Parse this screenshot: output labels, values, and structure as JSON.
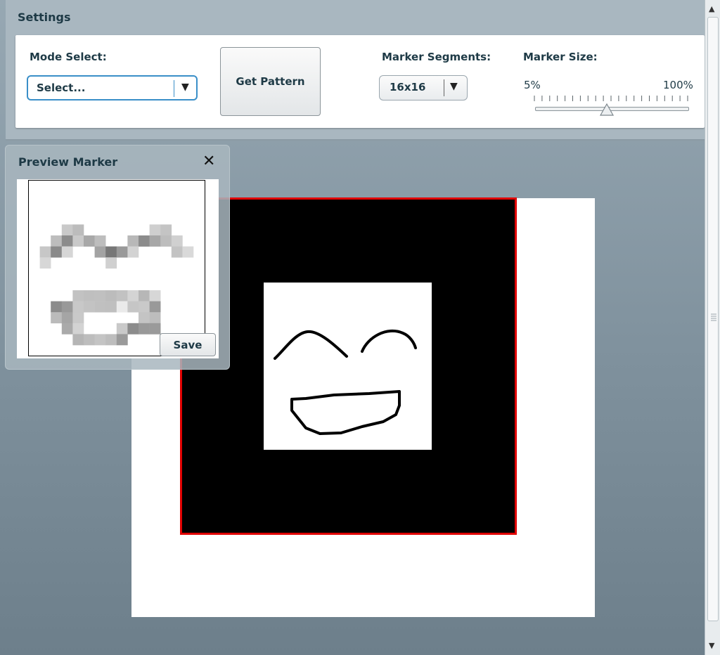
{
  "settings": {
    "title": "Settings",
    "mode_select": {
      "label": "Mode Select:",
      "value": "Select..."
    },
    "get_pattern_label": "Get Pattern",
    "marker_segments": {
      "label": "Marker Segments:",
      "value": "16x16"
    },
    "marker_size": {
      "label": "Marker Size:",
      "min_label": "5%",
      "max_label": "100%",
      "value_fraction": 0.47
    }
  },
  "preview": {
    "title": "Preview Marker",
    "save_label": "Save"
  },
  "colors": {
    "accent": "#3a8fc8",
    "marker_border": "#e00000",
    "marker_fill": "#000000"
  },
  "icons": {
    "close": "close-icon",
    "dropdown": "chevron-down-icon",
    "slider_thumb": "slider-thumb-icon",
    "scroll_up": "arrow-up-icon",
    "scroll_down": "arrow-down-icon"
  }
}
